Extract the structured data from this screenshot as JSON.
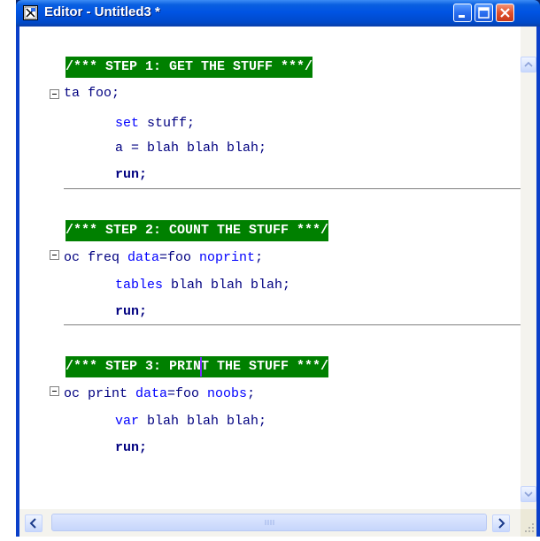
{
  "window": {
    "title": "Editor - Untitled3 *",
    "icons": {
      "app": "sas-editor-icon",
      "minimize": "minimize-icon",
      "maximize": "maximize-icon",
      "close": "close-icon"
    }
  },
  "editor": {
    "step1_comment": "/*** STEP 1: GET THE STUFF ***/",
    "step1": {
      "line1_kw": "data",
      "line1_rest": " foo;",
      "line2_kw": "set",
      "line2_rest": " stuff;",
      "line3": "a = blah blah blah;",
      "line4": "run;"
    },
    "step2_comment": "/*** STEP 2: COUNT THE STUFF ***/",
    "step2": {
      "line1_kw": "proc freq",
      "line1_opt1": " data",
      "line1_mid": "=foo ",
      "line1_opt2": "noprint",
      "line1_end": ";",
      "line2_kw": "tables",
      "line2_rest": " blah blah blah;",
      "line3": "run;"
    },
    "step3_comment_a": "/*** STEP 3",
    "step3_comment_b": ": PRINT THE STUFF ***/",
    "step3": {
      "line1_kw": "proc print",
      "line1_opt1": " data",
      "line1_mid": "=foo ",
      "line1_opt2": "noobs",
      "line1_end": ";",
      "line2_kw": "var",
      "line2_rest": " blah blah blah;",
      "line3": "run;"
    }
  },
  "scrollbars": {
    "up_icon": "scroll-up-icon",
    "down_icon": "scroll-down-icon",
    "left_icon": "scroll-left-icon",
    "right_icon": "scroll-right-icon"
  },
  "colors": {
    "comment_bg": "#008000",
    "keyword": "#000080",
    "option": "#0000ff",
    "titlebar": "#0054e3"
  }
}
